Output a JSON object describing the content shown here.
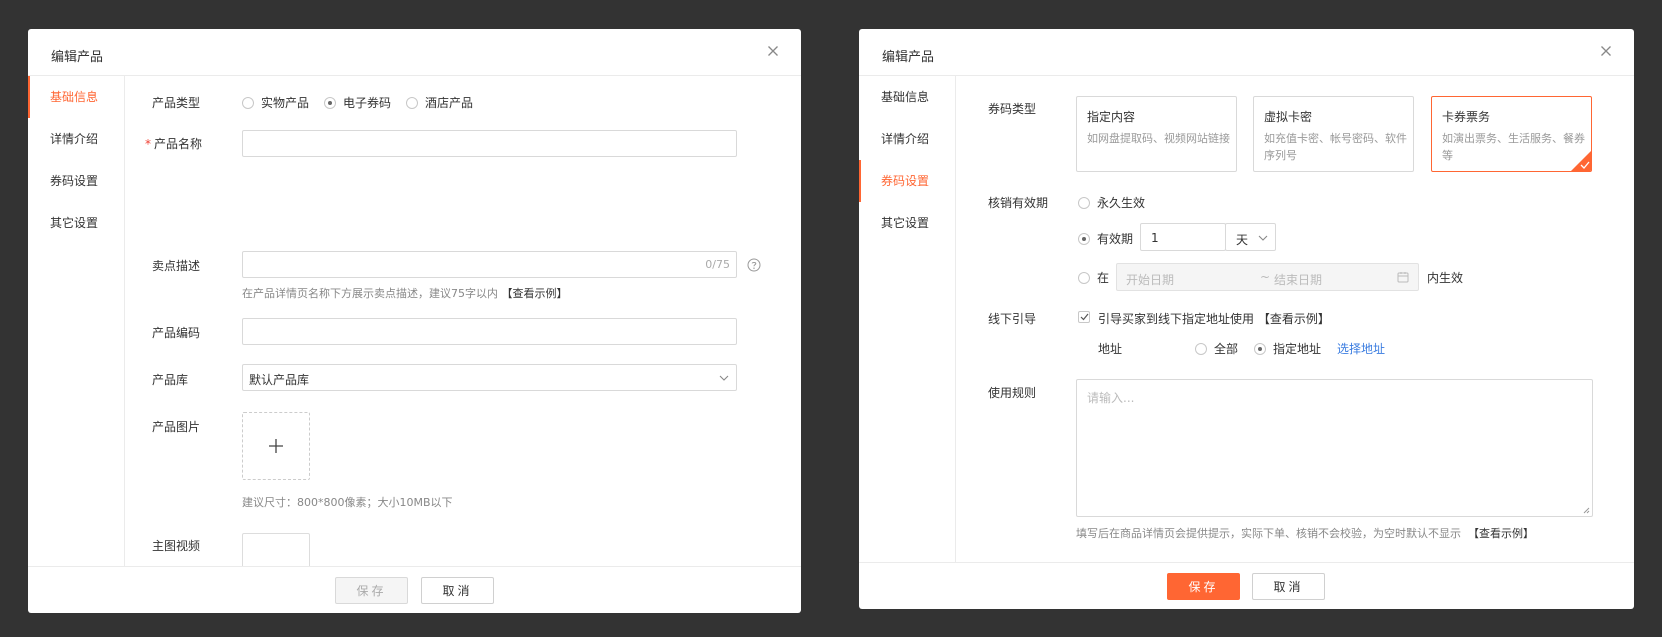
{
  "left_modal": {
    "title": "编辑产品",
    "sidebar": [
      "基础信息",
      "详情介绍",
      "券码设置",
      "其它设置"
    ],
    "product_type": {
      "label": "产品类型",
      "options": [
        "实物产品",
        "电子券码",
        "酒店产品"
      ],
      "selected": "电子券码"
    },
    "product_name": {
      "required_mark": "*",
      "label": "产品名称",
      "value": ""
    },
    "selling_point": {
      "label": "卖点描述",
      "counter": "0/75",
      "hint": "在产品详情页名称下方展示卖点描述，建议75字以内",
      "hint_link": "【查看示例】"
    },
    "product_code": {
      "label": "产品编码",
      "value": ""
    },
    "library": {
      "label": "产品库",
      "value": "默认产品库"
    },
    "images": {
      "label": "产品图片",
      "upload_icon": "plus-icon",
      "hint": "建议尺寸：800*800像素；大小10MB以下"
    },
    "video": {
      "label": "主图视频"
    },
    "footer": {
      "save": "保存",
      "cancel": "取消"
    }
  },
  "right_modal": {
    "title": "编辑产品",
    "sidebar": [
      "基础信息",
      "详情介绍",
      "券码设置",
      "其它设置"
    ],
    "coupon_type": {
      "label": "券码类型",
      "cards": [
        {
          "title": "指定内容",
          "desc": "如网盘提取码、视频网站链接"
        },
        {
          "title": "虚拟卡密",
          "desc": "如充值卡密、帐号密码、软件序列号"
        },
        {
          "title": "卡券票务",
          "desc": "如演出票务、生活服务、餐券等"
        }
      ],
      "selected": "卡券票务"
    },
    "validity": {
      "label": "核销有效期",
      "forever": "永久生效",
      "period": "有效期",
      "period_value": "1",
      "period_unit": "天",
      "range_prefix": "在",
      "start_placeholder": "开始日期",
      "separator": "~",
      "end_placeholder": "结束日期",
      "range_suffix": "内生效",
      "selected": "有效期"
    },
    "offline": {
      "label": "线下引导",
      "checkbox": "引导买家到线下指定地址使用",
      "checked": true,
      "example": "【查看示例】",
      "address_label": "地址",
      "address_options": [
        "全部",
        "指定地址"
      ],
      "address_selected": "指定地址",
      "choose_address": "选择地址"
    },
    "rules": {
      "label": "使用规则",
      "placeholder": "请输入...",
      "hint": "填写后在商品详情页会提供提示，实际下单、核销不会校验，为空时默认不显示",
      "hint_link": "【查看示例】"
    },
    "footer": {
      "save": "保存",
      "cancel": "取消"
    }
  },
  "colors": {
    "accent": "#ff6633",
    "link": "#3a7ce0",
    "backdrop": "#333333"
  }
}
